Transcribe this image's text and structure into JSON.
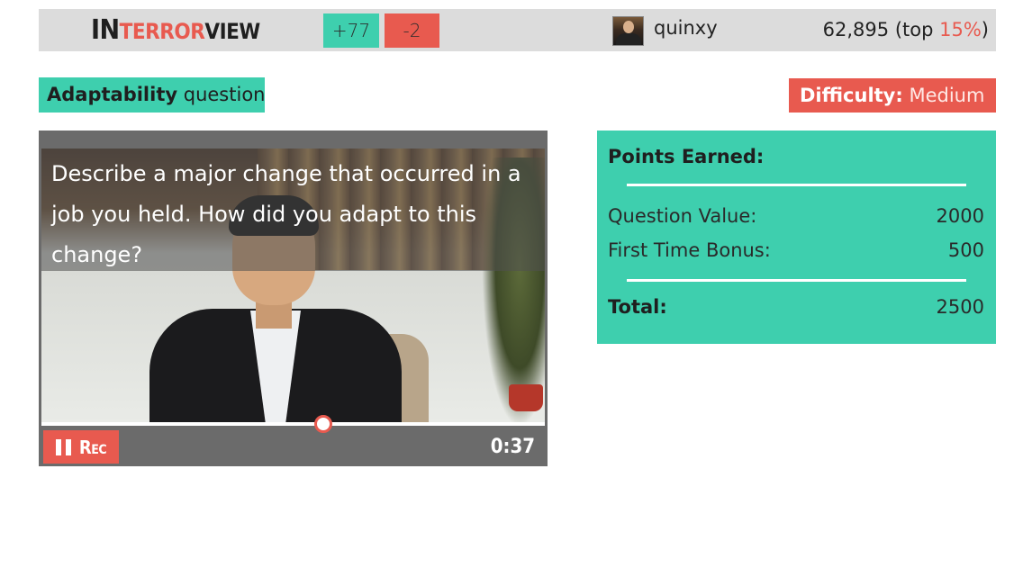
{
  "header": {
    "logo": {
      "part1": "In",
      "part2": "terror",
      "part3": "view"
    },
    "plus_badge": "+77",
    "minus_badge": "-2",
    "username": "quinxy",
    "score": "62,895",
    "rank_prefix": "(top ",
    "rank_pct": "15%",
    "rank_suffix": ")"
  },
  "question_meta": {
    "category_bold": "Adaptability",
    "category_light": "question",
    "difficulty_label": "Difficulty:",
    "difficulty_value": "Medium"
  },
  "video": {
    "question_text": "Describe a major change that occurred in a job you held. How did you adapt to this change?",
    "record_label": "Rec",
    "timer": "0:37",
    "progress": 0.56
  },
  "points": {
    "title": "Points Earned:",
    "rows": [
      {
        "label": "Question Value:",
        "value": "2000"
      },
      {
        "label": "First Time Bonus:",
        "value": "500"
      }
    ],
    "total_label": "Total:",
    "total_value": "2500"
  },
  "colors": {
    "accent_green": "#3ecfae",
    "accent_red": "#e85a4f",
    "topbar_bg": "#dcdcdc"
  }
}
